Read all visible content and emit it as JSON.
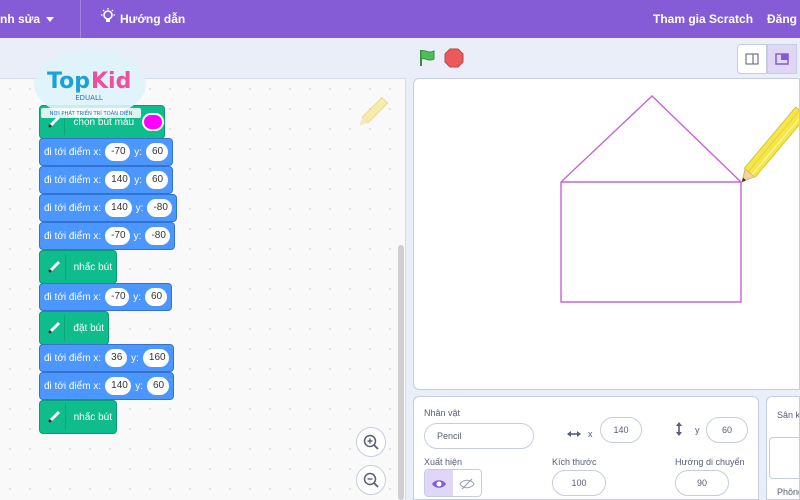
{
  "menubar": {
    "edit_label": "nh sửa",
    "tutorials_label": "Hướng dẫn",
    "join_label": "Tham gia Scratch",
    "signin_label": "Đăng n"
  },
  "logo": {
    "brand": "TopKid",
    "sub": "EDUALL",
    "tagline": "NƠI PHÁT TRIỂN TRÍ TOÀN DIỆN"
  },
  "blocks": {
    "set_pen_color": "chọn bút màu",
    "pen_color": "#ff00ff",
    "goto_label": "đi tới điểm x:",
    "y_label": "y:",
    "pen_up": "nhấc bút",
    "pen_down": "đặt bút",
    "goto_values": [
      {
        "x": "-70",
        "y": "60"
      },
      {
        "x": "140",
        "y": "60"
      },
      {
        "x": "140",
        "y": "-80"
      },
      {
        "x": "-70",
        "y": "-80"
      },
      {
        "x": "-70",
        "y": "60"
      },
      {
        "x": "36",
        "y": "160"
      },
      {
        "x": "140",
        "y": "60"
      }
    ]
  },
  "sprite": {
    "sprite_label": "Nhân vật",
    "name": "Pencil",
    "x_label": "x",
    "x": "140",
    "y_label": "y",
    "y": "60",
    "show_label": "Xuất hiện",
    "size_label": "Kích thước",
    "size": "100",
    "direction_label": "Hướng di chuyển",
    "direction": "90"
  },
  "backdrop": {
    "stage_label": "Sân k",
    "backdrops_label": "Phông"
  },
  "colors": {
    "menubar": "#855cd6",
    "motion_block": "#4c97ff",
    "pen_block": "#0fbd8c",
    "drawing_line": "#c864d8"
  }
}
